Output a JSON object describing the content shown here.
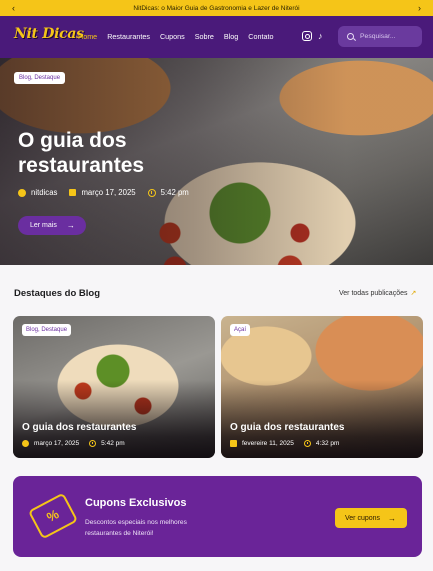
{
  "topbar": {
    "text": "NitDicas: o Maior Guia de Gastronomia e Lazer de Niterói",
    "prev": "‹",
    "next": "›"
  },
  "nav": {
    "logo": "Nit Dicas",
    "links": [
      "Home",
      "Restaurantes",
      "Cupons",
      "Sobre",
      "Blog",
      "Contato"
    ],
    "active": "Home",
    "social": [
      "instagram-icon",
      "tiktok-icon"
    ],
    "search_placeholder": "Pesquisar..."
  },
  "hero": {
    "tag": "Blog, Destaque",
    "title": "O guia dos restaurantes",
    "author": "nitdicas",
    "date": "março 17, 2025",
    "time": "5:42 pm",
    "cta": "Ler mais",
    "cta_arrow": "→"
  },
  "blog": {
    "title": "Destaques do Blog",
    "see_all": "Ver todas publicações",
    "see_all_arrow": "↗",
    "cards": [
      {
        "tag": "Blog, Destaque",
        "title": "O guia dos restaurantes",
        "date": "março 17, 2025",
        "time": "5:42 pm"
      },
      {
        "tag": "Açaí",
        "title": "O guia dos restaurantes",
        "date": "fevereire 11, 2025",
        "time": "4:32 pm"
      }
    ]
  },
  "coupon": {
    "icon_text": "%",
    "title": "Cupons Exclusivos",
    "text": "Descontos especiais nos melhores restaurantes de Niterói!",
    "cta": "Ver cupons",
    "cta_arrow": "→"
  },
  "colors": {
    "brand_purple": "#4a1a7a",
    "accent_yellow": "#f5c518",
    "coupon_purple": "#6a2498"
  }
}
